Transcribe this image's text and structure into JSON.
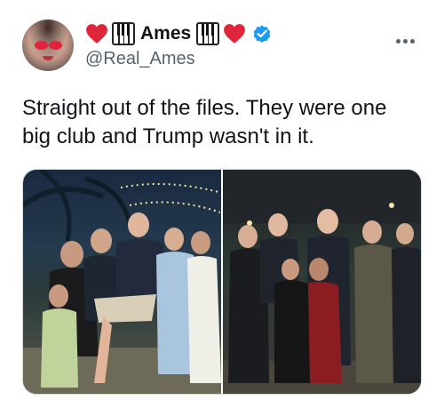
{
  "tweet": {
    "display_name": "Ames",
    "handle": "@Real_Ames",
    "text_line1": "Straight out of the files. They were one",
    "text_line2": "big club and Trump wasn't in it."
  },
  "icons": {
    "heart": "heart-emoji",
    "piano": "piano-keys-emoji",
    "verified": "verified-badge",
    "more": "more-options-icon"
  },
  "colors": {
    "heart": "#e0253a",
    "verified": "#1d9bf0",
    "text": "#0f1419",
    "secondary": "#536471"
  }
}
